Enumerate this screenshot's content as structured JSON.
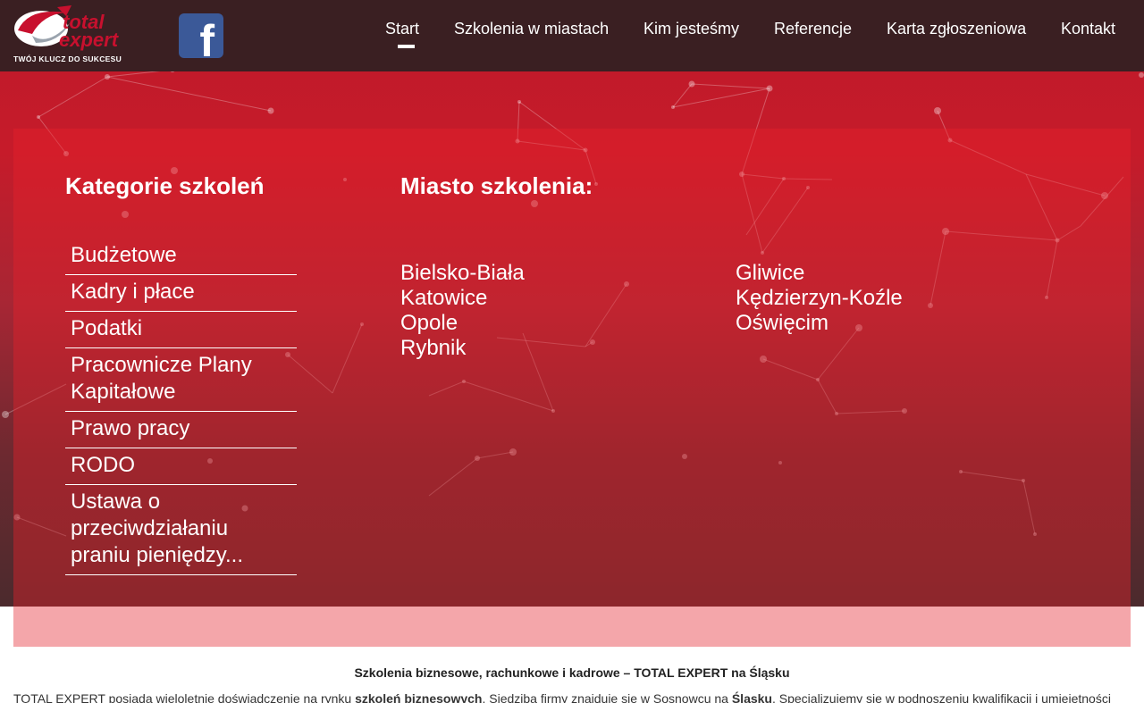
{
  "header": {
    "logo": {
      "word1": "total",
      "word2": "expert",
      "slogan": "TWÓJ KLUCZ DO SUKCESU"
    },
    "facebook_glyph": "f",
    "nav": [
      {
        "label": "Start",
        "active": true
      },
      {
        "label": "Szkolenia w miastach"
      },
      {
        "label": "Kim jesteśmy"
      },
      {
        "label": "Referencje"
      },
      {
        "label": "Karta zgłoszeniowa"
      },
      {
        "label": "Kontakt"
      }
    ]
  },
  "categories": {
    "title": "Kategorie szkoleń",
    "items": [
      "Budżetowe",
      "Kadry i płace",
      "Podatki",
      "Pracownicze Plany Kapitałowe",
      "Prawo pracy",
      "RODO",
      "Ustawa o przeciwdziałaniu praniu pieniędzy..."
    ]
  },
  "cities": {
    "title": "Miasto szkolenia:",
    "col1": [
      "Bielsko-Biała",
      "Katowice",
      "Opole",
      "Rybnik"
    ],
    "col2": [
      "Gliwice",
      "Kędzierzyn-Koźle",
      "Oświęcim"
    ]
  },
  "intro": {
    "title": "Szkolenia biznesowe, rachunkowe i kadrowe – TOTAL EXPERT na Śląsku",
    "text_a": "TOTAL EXPERT posiada wieloletnie doświadczenie na rynku ",
    "text_b": "szkoleń biznesowych",
    "text_c": ". Siedziba firmy znajduje się w Sosnowcu na ",
    "text_d": "Śląsku",
    "text_e": ". Specjalizujemy się w podnoszeniu kwalifikacji i umiejętności"
  },
  "colors": {
    "header_bg": "#3a1f22",
    "accent_red": "#c61b2a",
    "facebook": "#3b5998"
  }
}
